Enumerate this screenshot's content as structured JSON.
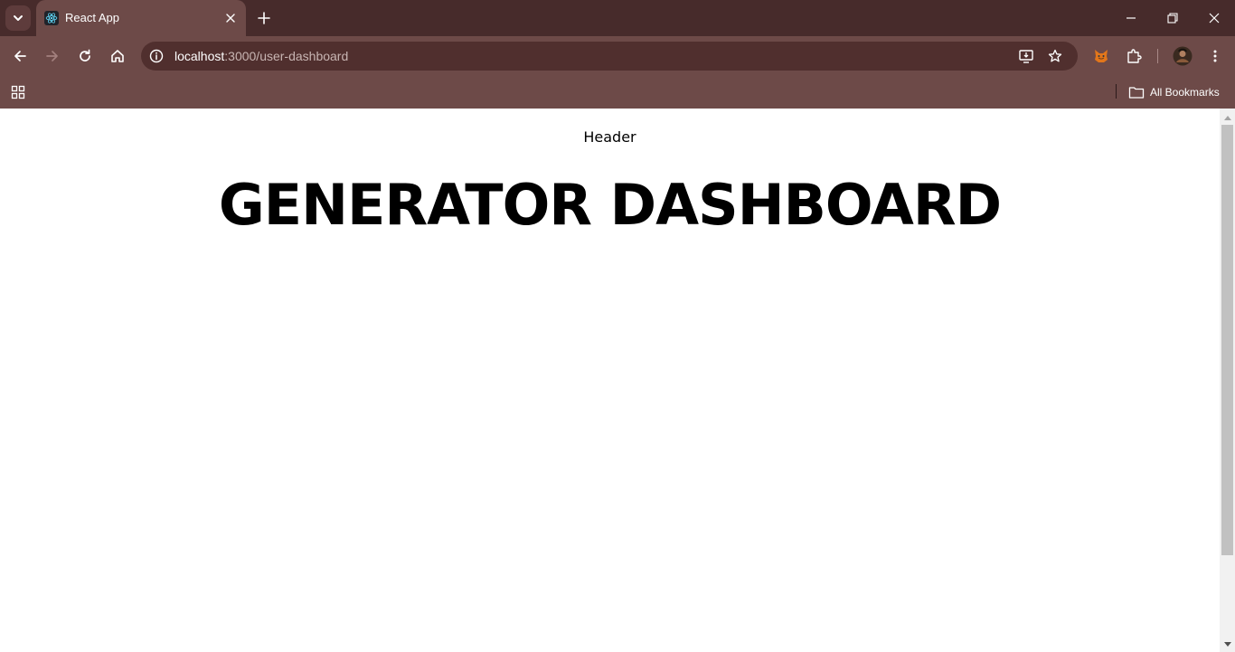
{
  "browser": {
    "tab": {
      "title": "React App",
      "favicon": "react-logo-icon"
    },
    "address_bar": {
      "host": "localhost",
      "path": ":3000/user-dashboard"
    },
    "bookmarks_bar": {
      "all_bookmarks_label": "All Bookmarks"
    },
    "icons": {
      "tab_search": "chevron-down-icon",
      "new_tab": "plus-icon",
      "back": "arrow-left-icon",
      "forward": "arrow-right-icon",
      "reload": "reload-icon",
      "home": "home-icon",
      "site_info": "info-icon",
      "install_app": "install-app-icon",
      "bookmark_star": "star-icon",
      "metamask": "fox-extension-icon",
      "extensions": "puzzle-icon",
      "profile": "avatar",
      "menu": "kebab-menu-icon",
      "apps": "apps-grid-icon",
      "folder": "folder-icon"
    }
  },
  "page": {
    "header_text": "Header",
    "title": "GENERATOR DASHBOARD"
  },
  "colors": {
    "titlebar_bg": "#472b2b",
    "toolbar_bg": "#6d4a48",
    "omnibox_bg": "#502f2e",
    "page_bg": "#ffffff",
    "text": "#000000"
  }
}
